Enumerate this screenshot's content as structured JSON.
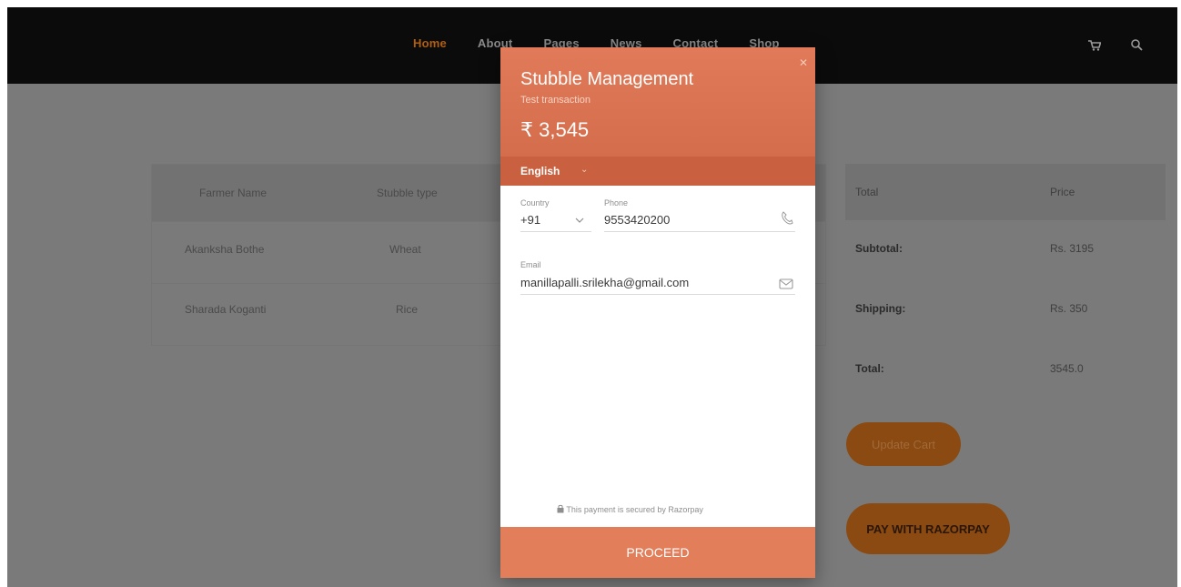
{
  "nav": {
    "items": [
      "Home",
      "About",
      "Pages",
      "News",
      "Contact",
      "Shop"
    ],
    "active_color": "#b05e12"
  },
  "icons": {
    "cart": "shopping-cart-icon",
    "search": "search-icon",
    "phone": "phone-icon",
    "email": "envelope-icon",
    "lock": "lock-icon"
  },
  "cart_table": {
    "headers": [
      "Farmer Name",
      "Stubble type"
    ],
    "rows": [
      [
        "Akanksha Bothe",
        "Wheat"
      ],
      [
        "Sharada Koganti",
        "Rice"
      ]
    ]
  },
  "totals": {
    "headers": [
      "Total",
      "Price"
    ],
    "rows": [
      [
        "Subtotal:",
        "Rs. 3195"
      ],
      [
        "Shipping:",
        "Rs. 350"
      ],
      [
        "Total:",
        "3545.0"
      ]
    ],
    "update_label": "Update Cart",
    "pay_label": "PAY WITH RAZORPAY"
  },
  "modal": {
    "title": "Stubble Management",
    "subtitle": "Test transaction",
    "amount": "₹ 3,545",
    "language": "English",
    "country_label": "Country",
    "country_value": "+91",
    "phone_label": "Phone",
    "phone_value": "9553420200",
    "email_label": "Email",
    "email_value": "manillapalli.srilekha@gmail.com",
    "secure_note": "This payment is secured by Razorpay",
    "proceed_label": "PROCEED",
    "accent_color": "#e07a58"
  }
}
